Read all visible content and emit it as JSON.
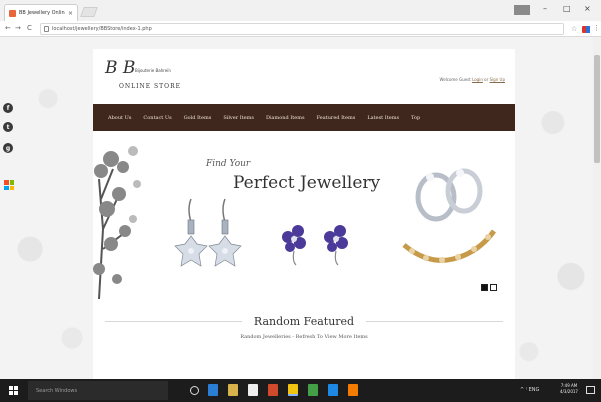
{
  "browser": {
    "tab_title": "BB Jewellery Online Store",
    "tab_close": "×",
    "url": "localhost/jewellery/BBStore/index-1.php",
    "back": "←",
    "forward": "→",
    "reload": "C",
    "star": "☆",
    "menu": "⋮",
    "minimize": "–",
    "maximize": "□",
    "close": "×"
  },
  "side_social": [
    {
      "icon": "facebook-icon",
      "glyph": "f"
    },
    {
      "icon": "twitter-icon",
      "glyph": "t"
    },
    {
      "icon": "google-plus-icon",
      "glyph": "g"
    }
  ],
  "site": {
    "logo_mark": "B B",
    "logo_sub": "Bijouterie Bahreïn",
    "logo_store": "ONLINE STORE",
    "welcome_text": "Welcome Guest",
    "login_link": "Login",
    "welcome_or": "or",
    "signup_link": "Sign Up",
    "nav": [
      "About Us",
      "Contact Us",
      "Gold Items",
      "Silver Items",
      "Diamond Items",
      "Featured Items",
      "Latest Items",
      "Top"
    ],
    "banner": {
      "script_text": "Find Your",
      "headline": "Perfect Jewellery"
    },
    "section_title": "Random Featured",
    "section_sub": "Random Jewelleries - Refresh To View More Items"
  },
  "taskbar": {
    "search_placeholder": "Search Windows",
    "tray_text": "^ ⁽ ENG",
    "time": "7:49 AM",
    "date": "4/3/2017"
  },
  "colors": {
    "nav_bg": "#3f271d",
    "nav_text": "#f0e4d8",
    "taskbar_bg": "#1c1c1c"
  }
}
